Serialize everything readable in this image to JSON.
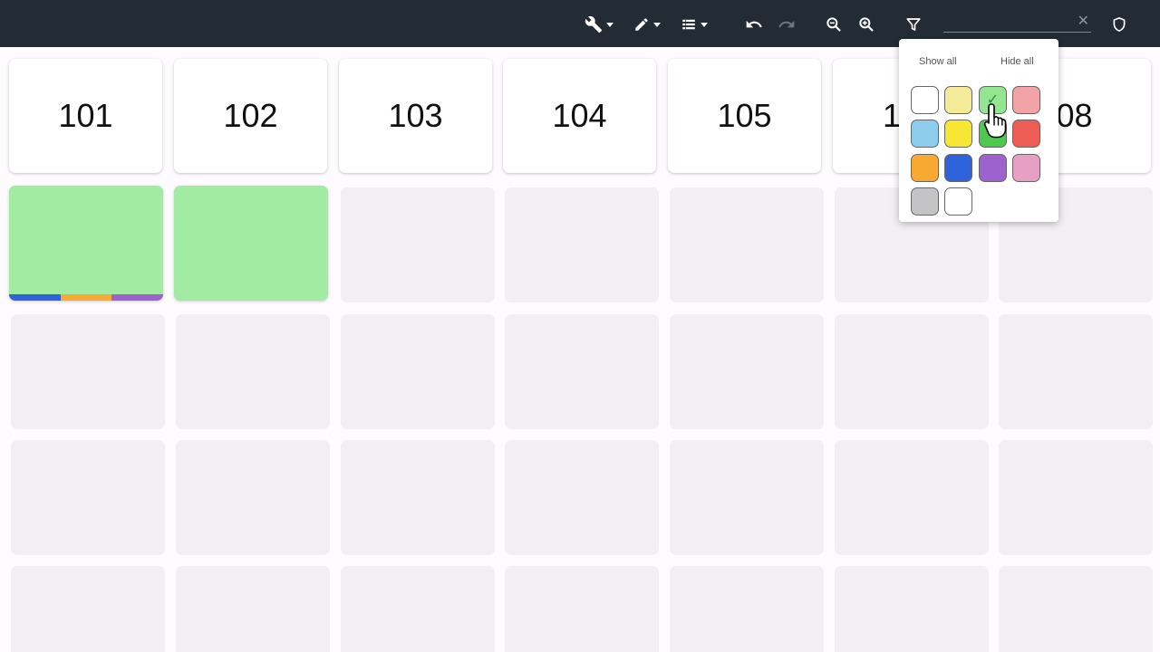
{
  "toolbar": {
    "tools_icon": "wrench-icon",
    "edit_icon": "pencil-icon",
    "view_icon": "list-icon",
    "undo_icon": "undo-icon",
    "redo_icon": "redo-icon",
    "zoom_out_icon": "zoom-out-icon",
    "zoom_in_icon": "zoom-in-icon",
    "filter_icon": "filter-icon",
    "search_value": "",
    "clear_label": "✕",
    "shield_icon": "shield-icon"
  },
  "header_cards": [
    {
      "label": "101"
    },
    {
      "label": "102"
    },
    {
      "label": "103"
    },
    {
      "label": "104"
    },
    {
      "label": "105"
    },
    {
      "label": "1"
    },
    {
      "label": "08"
    }
  ],
  "filter_popup": {
    "show_all": "Show all",
    "hide_all": "Hide all",
    "swatches": [
      {
        "color": "#ffffff",
        "checked": false
      },
      {
        "color": "#f5ea97",
        "checked": false
      },
      {
        "color": "#93e590",
        "checked": true
      },
      {
        "color": "#f1a3a5",
        "checked": false
      },
      {
        "color": "#8ccdee",
        "checked": false
      },
      {
        "color": "#f8e634",
        "checked": false
      },
      {
        "color": "#4cc94e",
        "checked": false
      },
      {
        "color": "#ee5e55",
        "checked": false
      },
      {
        "color": "#f7a932",
        "checked": false
      },
      {
        "color": "#2f63dc",
        "checked": false
      },
      {
        "color": "#9e62cf",
        "checked": false
      },
      {
        "color": "#e7a0c3",
        "checked": false
      },
      {
        "color": "#c4c3c5",
        "checked": false
      },
      {
        "color": "#ffffff",
        "checked": false
      }
    ],
    "check_mark": "✓"
  },
  "colors": {
    "toolbar_bg": "#232c35",
    "green_card": "#a1eba3",
    "empty_card": "#f1eff2",
    "stripe": [
      "#2f63dc",
      "#f7a932",
      "#9e62cf"
    ]
  }
}
